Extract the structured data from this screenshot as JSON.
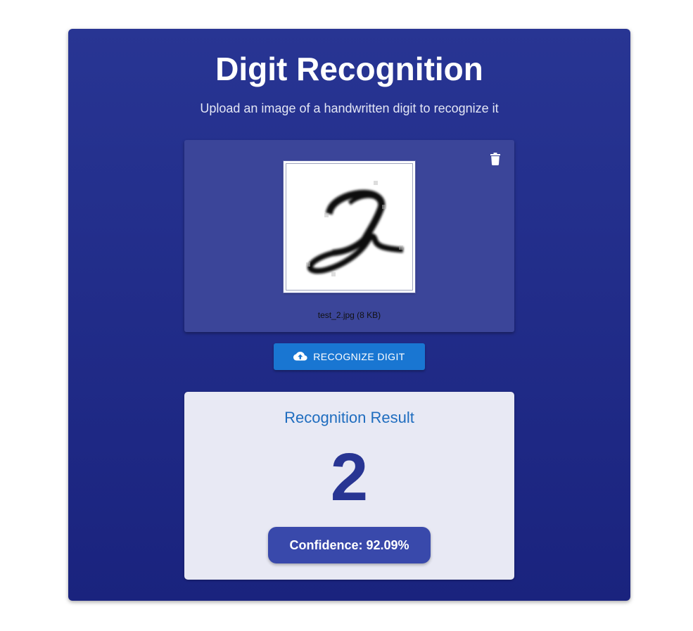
{
  "header": {
    "title": "Digit Recognition",
    "subtitle": "Upload an image of a handwritten digit to recognize it"
  },
  "upload": {
    "file_name": "test_2.jpg (8 KB)",
    "delete_icon": "trash-icon",
    "preview_icon": "handwritten-digit-image"
  },
  "actions": {
    "recognize_label": "RECOGNIZE DIGIT",
    "recognize_icon": "cloud-upload-icon"
  },
  "result": {
    "title": "Recognition Result",
    "digit": "2",
    "confidence_label": "Confidence: 92.09%"
  },
  "colors": {
    "panel_top": "#283593",
    "panel_bottom": "#1a237e",
    "upload_box": "#3b4599",
    "button": "#1976d2",
    "result_card": "#e8e9f4",
    "result_title": "#1f6dbf",
    "digit": "#283593",
    "confidence_badge": "#3949ab"
  }
}
